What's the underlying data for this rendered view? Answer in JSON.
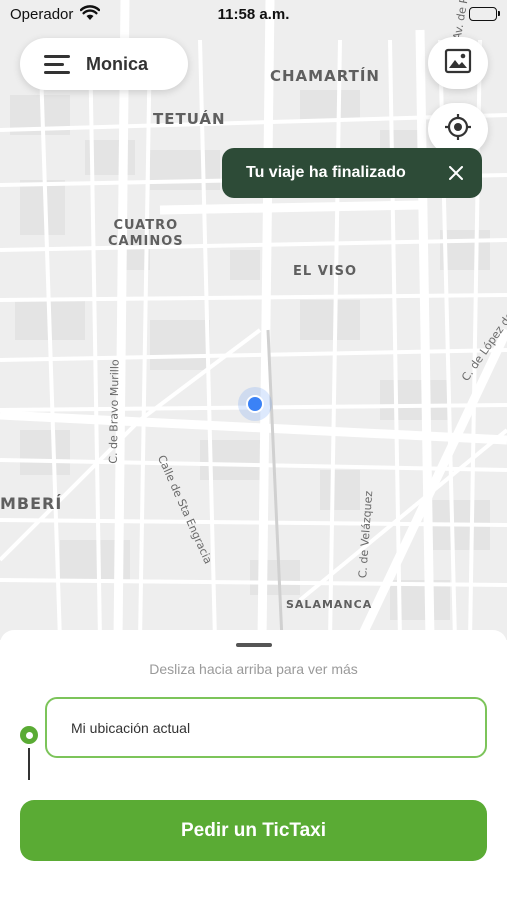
{
  "status_bar": {
    "carrier": "Operador",
    "time": "11:58 a.m."
  },
  "user": {
    "name": "Monica"
  },
  "map": {
    "districts": [
      {
        "id": "chamartin",
        "name": "CHAMARTÍN"
      },
      {
        "id": "tetuan",
        "name": "TETUÁN"
      },
      {
        "id": "cuatro-caminos",
        "name": "CUATRO\nCAMINOS"
      },
      {
        "id": "el-viso",
        "name": "EL VISO"
      },
      {
        "id": "chamberi",
        "name": "MBERÍ"
      },
      {
        "id": "salamanca",
        "name": "SALAMANCA"
      }
    ],
    "streets": [
      {
        "id": "bravo-murillo",
        "name": "C. de Bravo Murillo"
      },
      {
        "id": "sta-engracia",
        "name": "Calle de Sta Engracia"
      },
      {
        "id": "velazquez",
        "name": "C. de Velázquez"
      },
      {
        "id": "lopez",
        "name": "C. de López de"
      },
      {
        "id": "av",
        "name": "Av. de P"
      }
    ]
  },
  "toast": {
    "message": "Tu viaje ha finalizado"
  },
  "sheet": {
    "hint": "Desliza hacia arriba para ver más",
    "origin_value": "Mi ubicación actual",
    "request_label": "Pedir un TicTaxi"
  },
  "colors": {
    "accent_green": "#5aab34",
    "toast_bg": "#2d4b37",
    "location_blue": "#3b82f6",
    "field_border": "#7cc45a"
  },
  "icons": {
    "menu": "menu-icon",
    "gallery": "image-icon",
    "recenter": "crosshair-icon",
    "close": "close-icon",
    "wifi": "wifi-icon",
    "battery": "battery-icon"
  }
}
